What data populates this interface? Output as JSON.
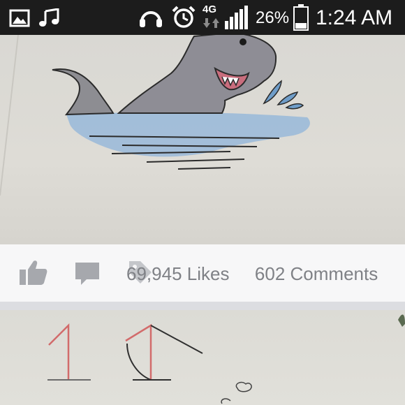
{
  "status_bar": {
    "network": "4G",
    "battery": "26%",
    "time": "1:24 AM",
    "icons": [
      "image-icon",
      "music-icon",
      "headphones-icon",
      "alarm-icon",
      "network-arrows-icon",
      "signal-icon",
      "battery-icon"
    ]
  },
  "post": {
    "likes_text": "69,945 Likes",
    "comments_text": "602 Comments",
    "actions": [
      "like-icon",
      "comment-icon",
      "tag-icon"
    ]
  },
  "colors": {
    "status_bar_bg": "#1c1c1c",
    "action_bar_bg": "#f7f7f8",
    "stats_text": "#7f8186",
    "icon_gray": "#a6a8ad"
  }
}
